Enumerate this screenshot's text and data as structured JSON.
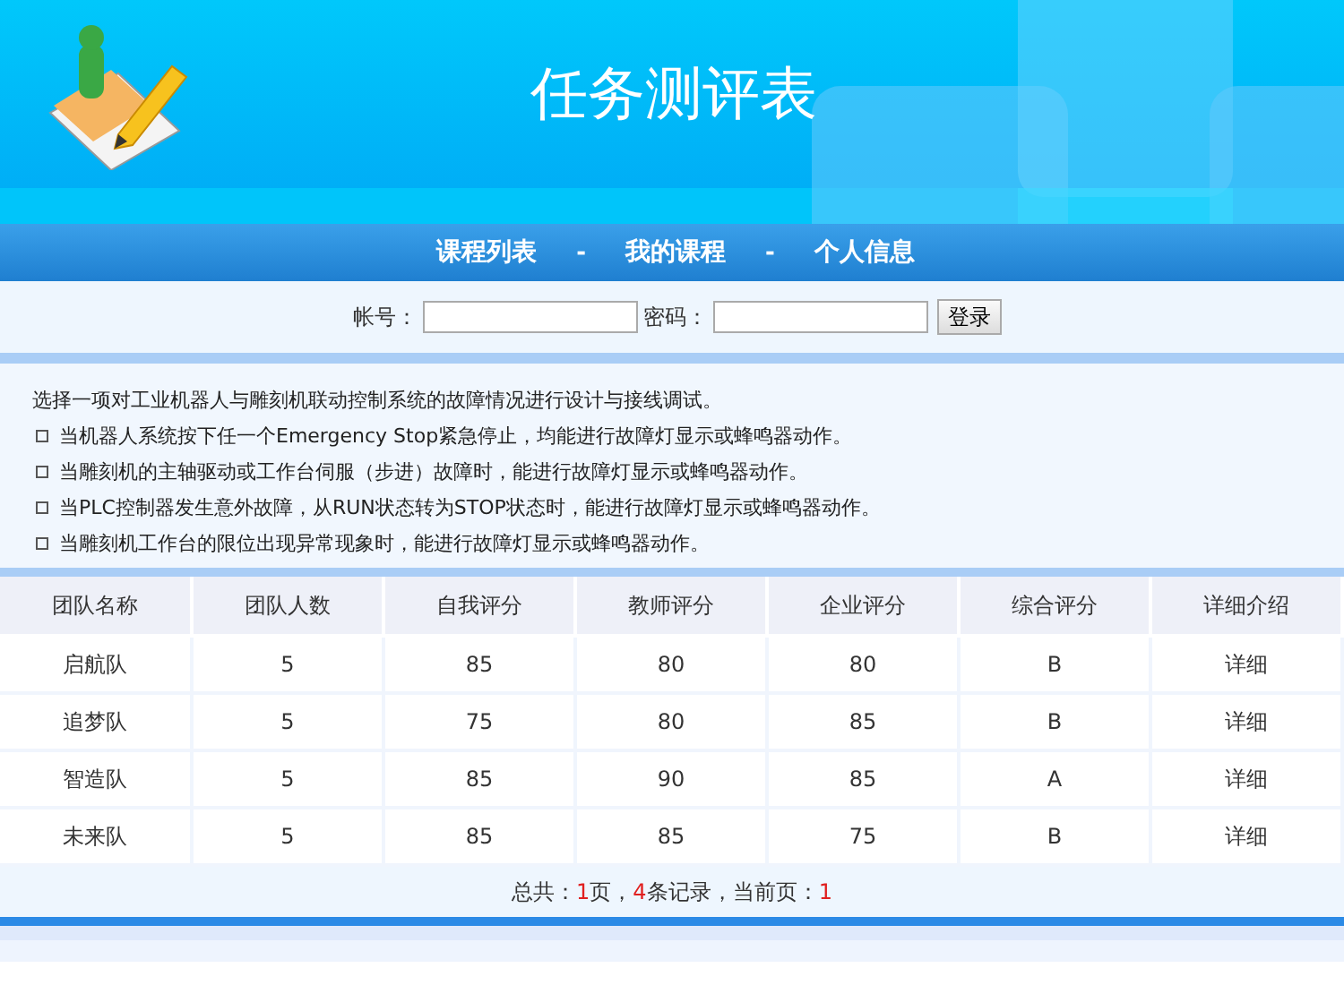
{
  "header": {
    "title": "任务测评表"
  },
  "nav": {
    "items": [
      {
        "label": "课程列表",
        "kind": "link"
      },
      {
        "label": "-",
        "kind": "separator"
      },
      {
        "label": "我的课程",
        "kind": "link"
      },
      {
        "label": "-",
        "kind": "separator"
      },
      {
        "label": "个人信息",
        "kind": "link"
      }
    ]
  },
  "login": {
    "account_label": "帐号：",
    "password_label": "密码：",
    "button": "登录"
  },
  "description": {
    "intro": "选择一项对工业机器人与雕刻机联动控制系统的故障情况进行设计与接线调试。",
    "items": [
      "当机器人系统按下任一个Emergency Stop紧急停止，均能进行故障灯显示或蜂鸣器动作。",
      "当雕刻机的主轴驱动或工作台伺服（步进）故障时，能进行故障灯显示或蜂鸣器动作。",
      "当PLC控制器发生意外故障，从RUN状态转为STOP状态时，能进行故障灯显示或蜂鸣器动作。",
      "当雕刻机工作台的限位出现异常现象时，能进行故障灯显示或蜂鸣器动作。"
    ]
  },
  "table": {
    "columns": [
      "团队名称",
      "团队人数",
      "自我评分",
      "教师评分",
      "企业评分",
      "综合评分",
      "详细介绍"
    ],
    "rows": [
      [
        "启航队",
        "5",
        "85",
        "80",
        "80",
        "B",
        "详细"
      ],
      [
        "追梦队",
        "5",
        "75",
        "80",
        "85",
        "B",
        "详细"
      ],
      [
        "智造队",
        "5",
        "85",
        "90",
        "85",
        "A",
        "详细"
      ],
      [
        "未来队",
        "5",
        "85",
        "85",
        "75",
        "B",
        "详细"
      ]
    ]
  },
  "pager": [
    {
      "text": "总共：",
      "highlight": false
    },
    {
      "text": "1",
      "highlight": true
    },
    {
      "text": "页，",
      "highlight": false
    },
    {
      "text": "4",
      "highlight": true
    },
    {
      "text": "条记录，当前页：",
      "highlight": false
    },
    {
      "text": "1",
      "highlight": true
    }
  ]
}
